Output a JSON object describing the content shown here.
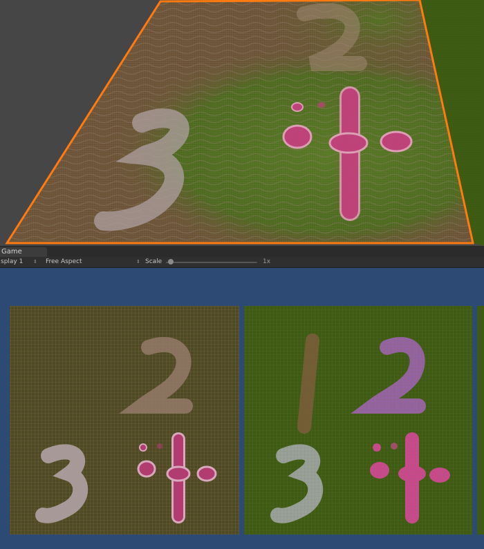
{
  "window": {
    "tab_label": "Game"
  },
  "toolbar": {
    "display_label": "splay 1",
    "aspect_label": "Free Aspect",
    "scale_label": "Scale",
    "scale_value": "1x",
    "scale_level": 0.02
  },
  "icons": {
    "display_dropdown": "up-down-arrows-icon",
    "aspect_dropdown": "up-down-arrows-icon",
    "scale_slider": "slider-thumb-icon"
  },
  "colors": {
    "scene_background": "#464646",
    "selection_outline": "#ff7a10",
    "terrain_brown": "#6b5236",
    "terrain_green": "#4a6a1c",
    "glyph_pink": "#c0407a",
    "glyph_gray": "#9a8c8c",
    "game_background": "#2c4a74"
  }
}
